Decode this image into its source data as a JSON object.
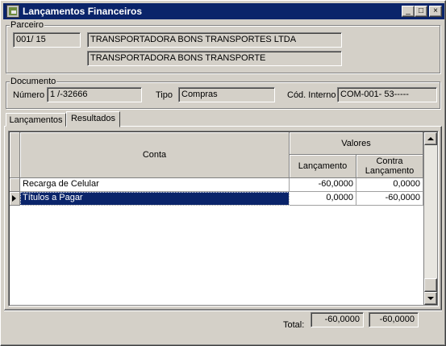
{
  "window": {
    "title": "Lançamentos Financeiros",
    "icon": "financial-app-icon",
    "controls": {
      "minimize": "_",
      "maximize": "□",
      "close": "×"
    }
  },
  "parceiro": {
    "legend": "Parceiro",
    "code": "001/   15",
    "name": "TRANSPORTADORA BONS TRANSPORTES LTDA",
    "fantasy_name": "TRANSPORTADORA BONS TRANSPORTE"
  },
  "documento": {
    "legend": "Documento",
    "numero_label": "Número",
    "numero": "1 /-32666",
    "tipo_label": "Tipo",
    "tipo": "Compras",
    "cod_interno_label": "Cód. Interno",
    "cod_interno": "COM-001-        53-----"
  },
  "tabs": [
    {
      "label": "Lançamentos",
      "active": false
    },
    {
      "label": "Resultados",
      "active": true
    }
  ],
  "grid": {
    "headers": {
      "conta": "Conta",
      "valores": "Valores",
      "lancamento": "Lançamento",
      "contra_lancamento": "Contra Lançamento"
    },
    "rows": [
      {
        "conta": "Recarga de Celular",
        "lancamento": "-60,0000",
        "contra": "0,0000",
        "selected": false
      },
      {
        "conta": "Títulos a Pagar",
        "lancamento": "0,0000",
        "contra": "-60,0000",
        "selected": true
      }
    ]
  },
  "totals": {
    "label": "Total:",
    "lancamento": "-60,0000",
    "contra": "-60,0000"
  }
}
